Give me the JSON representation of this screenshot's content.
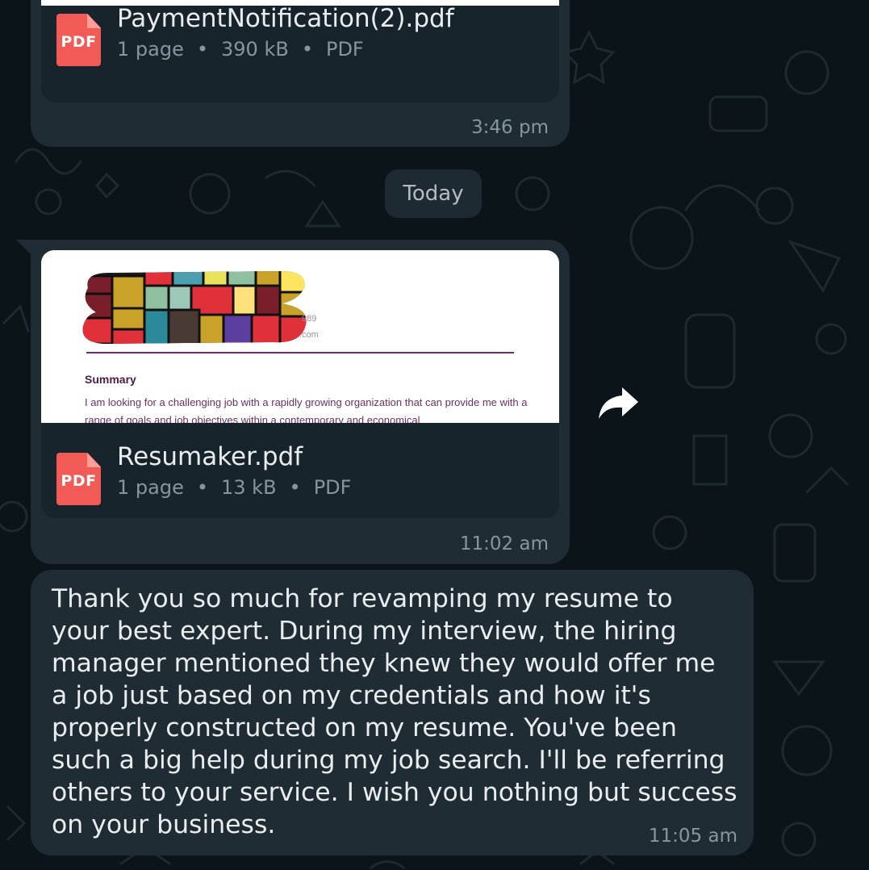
{
  "messages": [
    {
      "type": "document",
      "file_name": "PaymentNotification(2).pdf",
      "icon_label": "PDF",
      "pages": "1 page",
      "size": "390 kB",
      "file_type": "PDF",
      "time": "3:46 pm"
    },
    {
      "type": "document",
      "file_name": "Resumaker.pdf",
      "icon_label": "PDF",
      "pages": "1 page",
      "size": "13 kB",
      "file_type": "PDF",
      "time": "11:02 am",
      "preview": {
        "heading": "Summary",
        "body": "I am looking for a challenging job with a rapidly growing organization that can provide me with a range of goals and job objectives within a contemporary and economical",
        "fragment_1": "989",
        "fragment_2": ".com"
      }
    },
    {
      "type": "text",
      "text": "Thank you so much for revamping my resume to your best expert. During my interview, the hiring manager mentioned they knew they would offer me a job just based on my credentials and how it's properly constructed on my resume. You've been such a big help during my job search. I'll be referring others to your service. I wish you nothing but success on your business.",
      "time": "11:05 am"
    }
  ],
  "date_separator": "Today",
  "meta_separator": "•",
  "colors": {
    "background": "#0b1418",
    "bubble": "#1f2c34",
    "file_card": "#18242b",
    "pdf_icon": "#f25b55",
    "text_primary": "#e9edef",
    "text_secondary": "#8696a0"
  },
  "icons": {
    "pdf": "pdf-file-icon",
    "forward": "forward-arrow-icon"
  }
}
